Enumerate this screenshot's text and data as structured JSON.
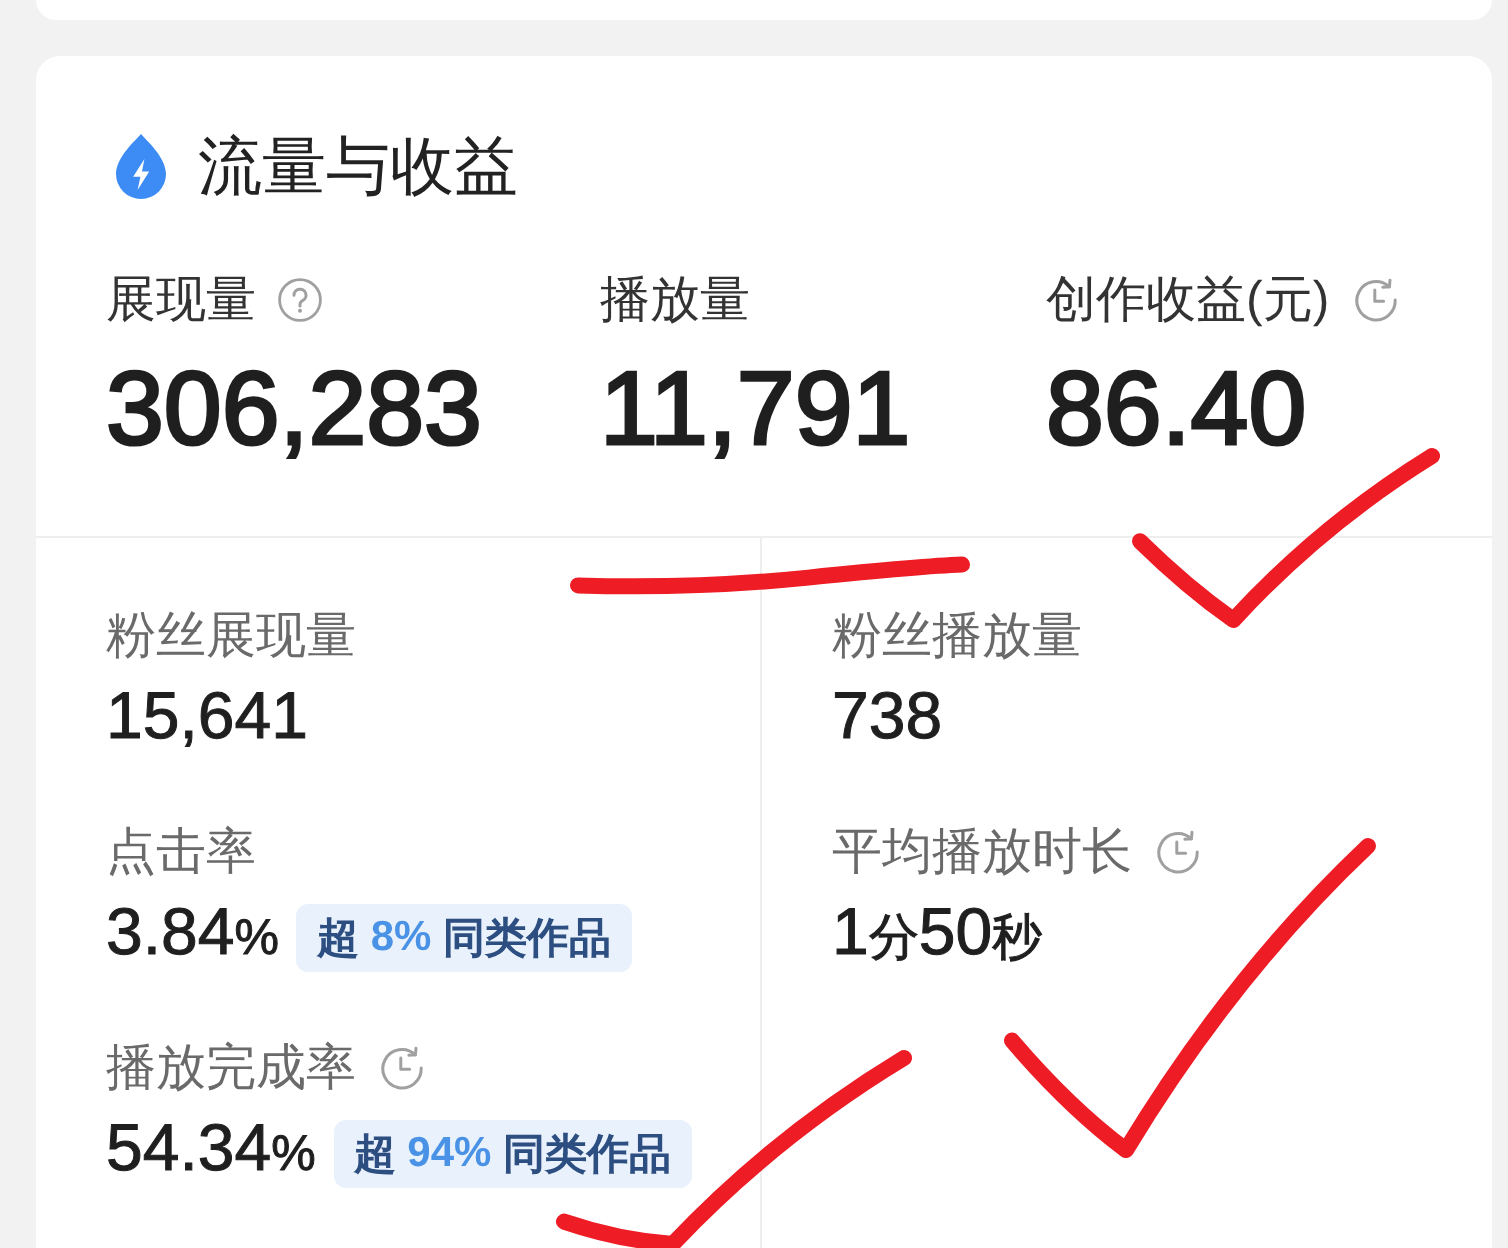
{
  "section": {
    "title": "流量与收益"
  },
  "headline_metrics": [
    {
      "label": "展现量",
      "kind": "help",
      "value": "306,283"
    },
    {
      "label": "播放量",
      "kind": "plain",
      "value": "11,791"
    },
    {
      "label": "创作收益(元)",
      "kind": "history",
      "value": "86.40"
    }
  ],
  "detail_columns": [
    {
      "metrics": [
        {
          "label": "粉丝展现量",
          "kind": "plain",
          "value": [
            {
              "text": "15,641",
              "kind": "number"
            }
          ]
        },
        {
          "label": "点击率",
          "kind": "plain",
          "value": [
            {
              "text": "3.84",
              "kind": "number"
            },
            {
              "text": "%",
              "kind": "unit"
            }
          ],
          "badge": {
            "lead": "超 ",
            "figure": "8%",
            "tail": " 同类作品"
          }
        },
        {
          "label": "播放完成率",
          "kind": "history",
          "value": [
            {
              "text": "54.34",
              "kind": "number"
            },
            {
              "text": "%",
              "kind": "unit"
            }
          ],
          "badge": {
            "lead": "超 ",
            "figure": "94%",
            "tail": " 同类作品"
          }
        }
      ]
    },
    {
      "metrics": [
        {
          "label": "粉丝播放量",
          "kind": "plain",
          "value": [
            {
              "text": "738",
              "kind": "number"
            }
          ]
        },
        {
          "label": "平均播放时长",
          "kind": "history",
          "value": [
            {
              "text": "1",
              "kind": "number"
            },
            {
              "text": "分",
              "kind": "unit"
            },
            {
              "text": "50",
              "kind": "number"
            },
            {
              "text": "秒",
              "kind": "unit"
            }
          ]
        }
      ]
    }
  ],
  "pen_marks": [
    {
      "kind": "underline"
    },
    {
      "kind": "check"
    },
    {
      "kind": "check"
    },
    {
      "kind": "check"
    }
  ]
}
